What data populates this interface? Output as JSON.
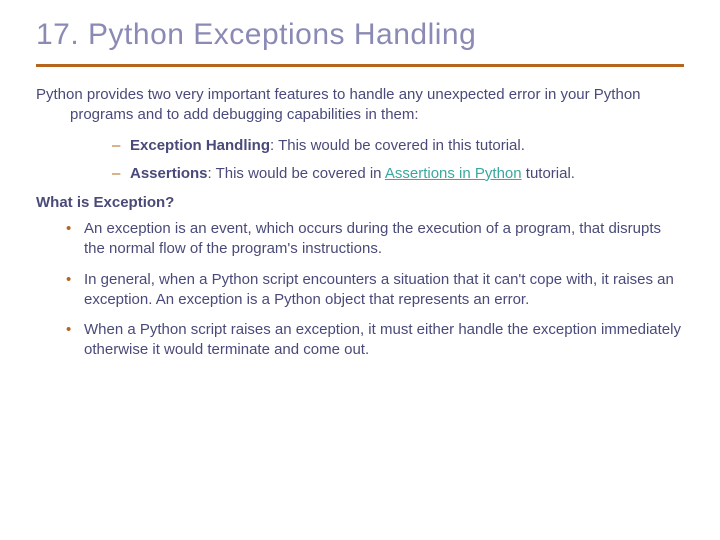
{
  "title": "17. Python Exceptions Handling",
  "intro": "Python provides two very important features to handle any unexpected error in your Python programs and to add debugging capabilities in them:",
  "sub": {
    "item1_bold": "Exception Handling",
    "item1_rest": ": This would be covered in this tutorial.",
    "item2_bold": "Assertions",
    "item2_mid": ": This would be covered in ",
    "item2_link": "Assertions in Python",
    "item2_end": " tutorial."
  },
  "subheading": "What is Exception?",
  "bullets": [
    "An exception is an event, which occurs during the execution of a program, that disrupts the normal flow of the program's instructions.",
    "In general, when a Python script encounters a situation that it can't cope with, it raises an exception. An exception is a Python object that represents an error.",
    "When a Python script raises an exception, it must either handle the exception immediately otherwise it would terminate and come out."
  ]
}
